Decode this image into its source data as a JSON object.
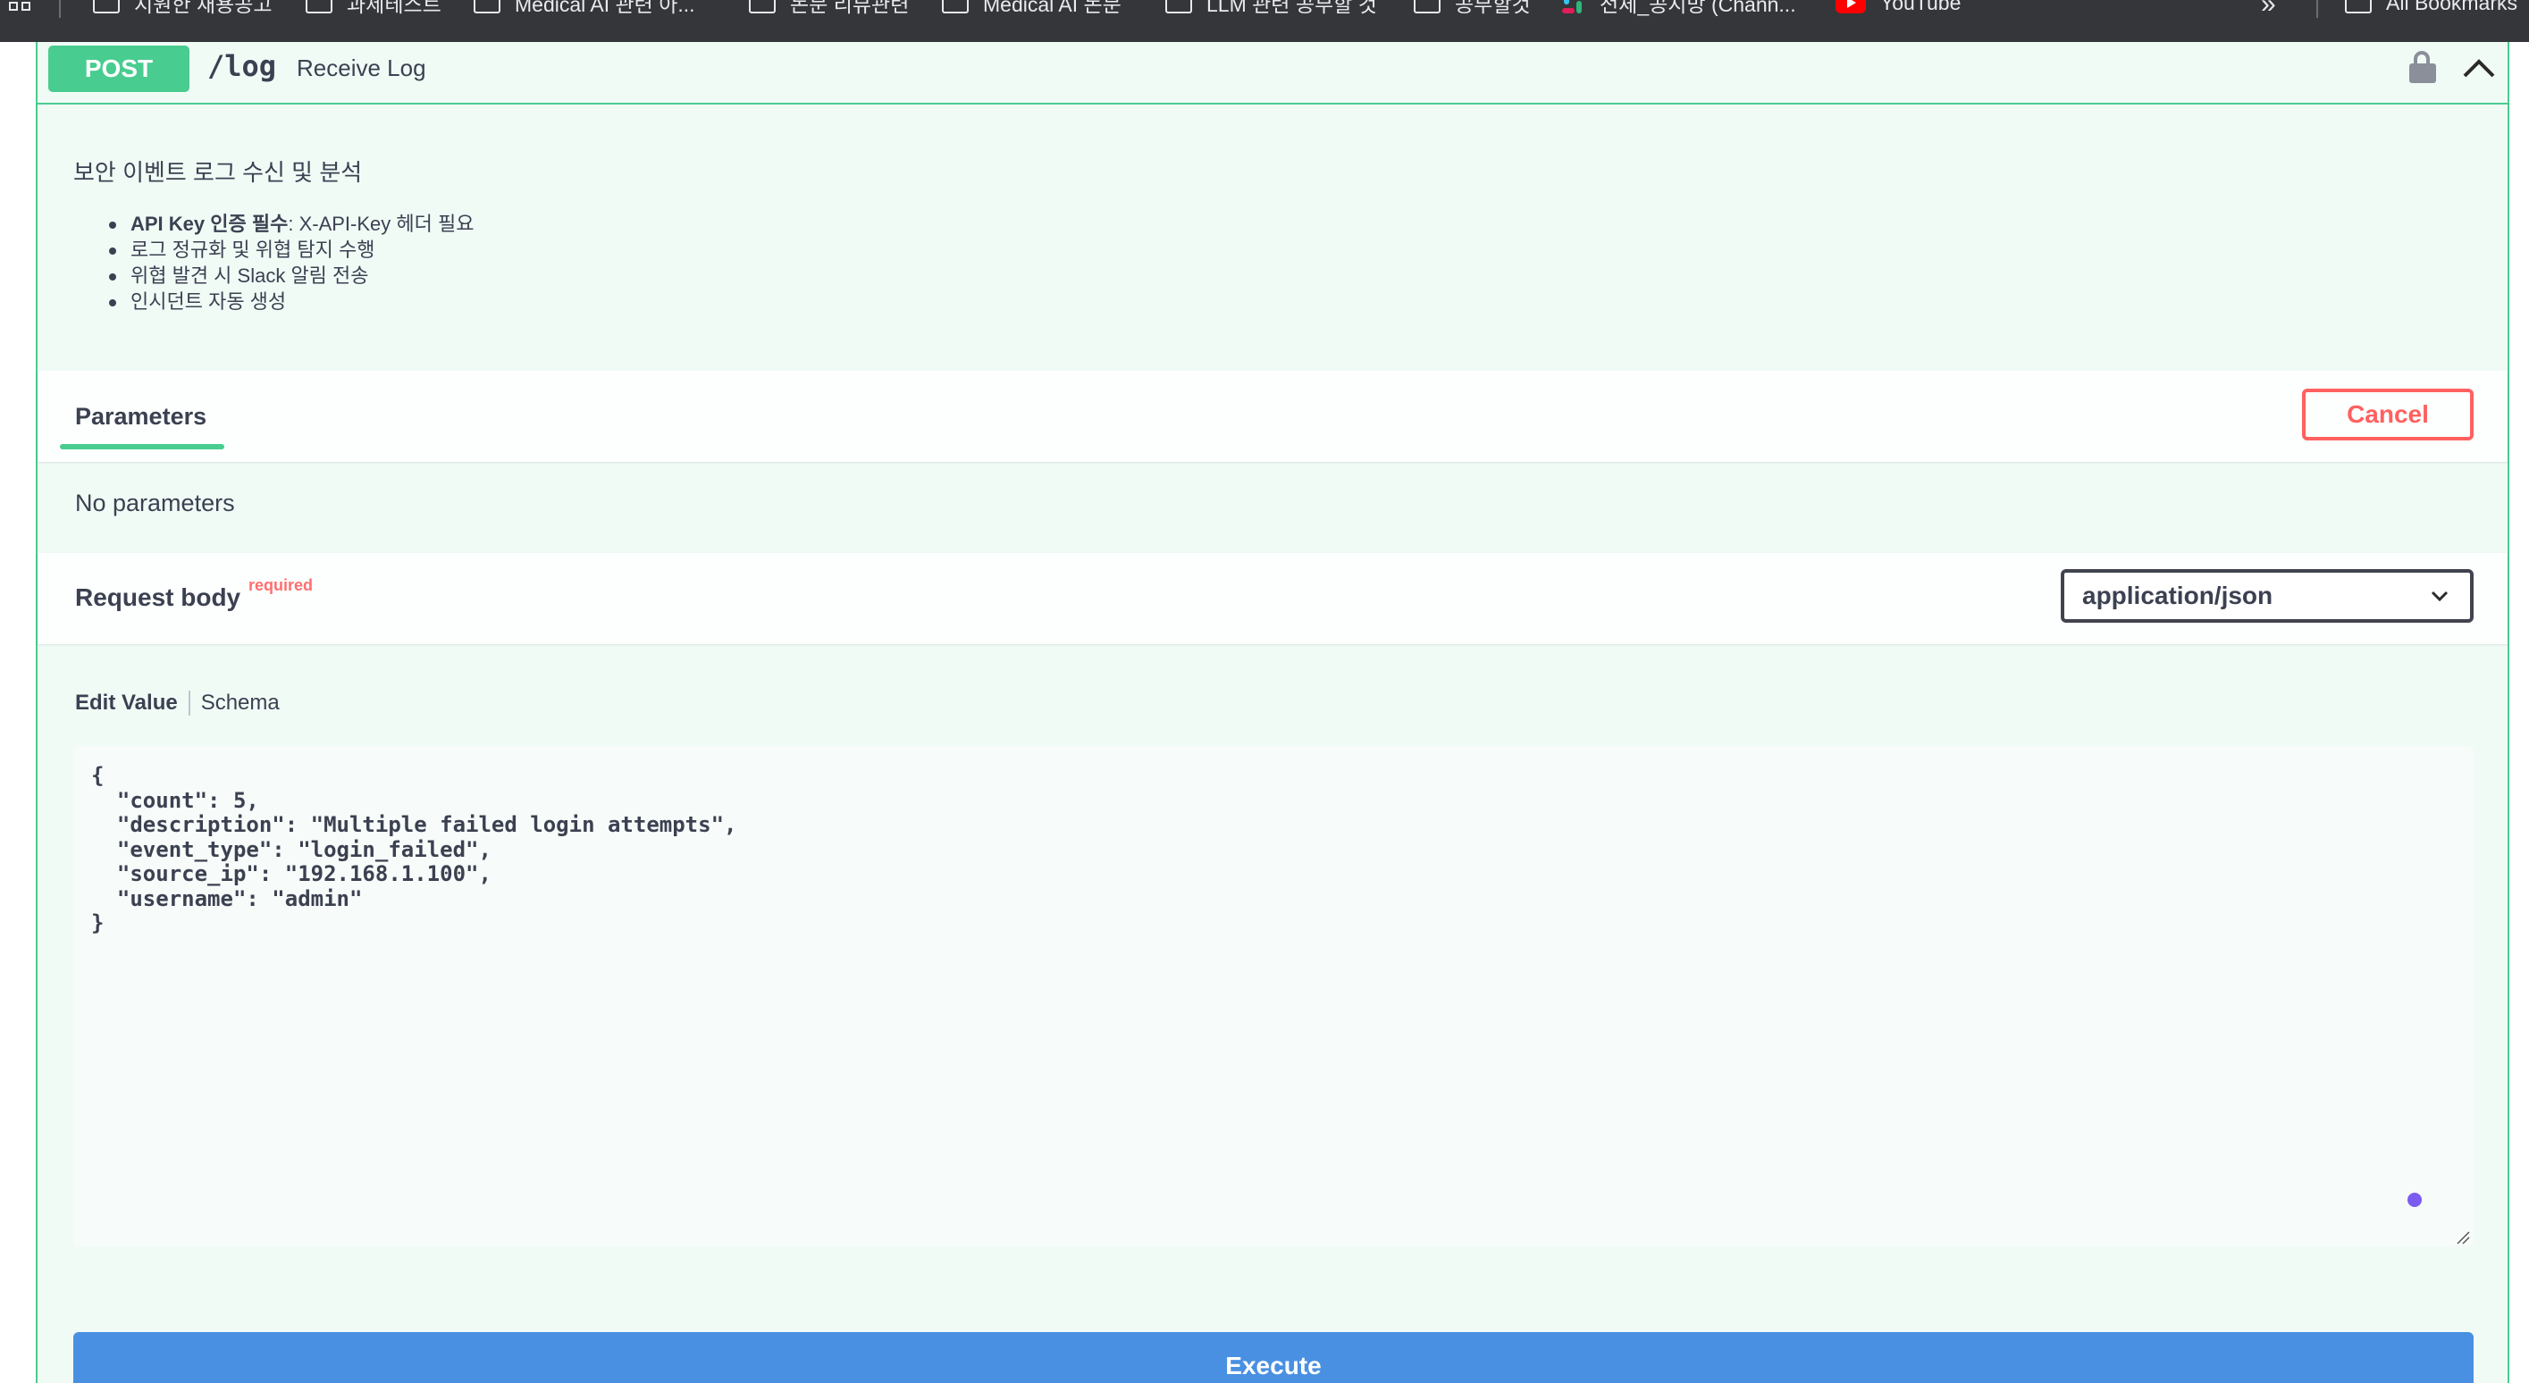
{
  "bookmarks": {
    "items": [
      {
        "label": "지원한 채용공고",
        "icon": "folder-icon"
      },
      {
        "label": "과제테스트",
        "icon": "folder-icon"
      },
      {
        "label": "Medical AI 관련 아...",
        "icon": "folder-icon"
      },
      {
        "label": "논문 리뷰관련",
        "icon": "folder-icon"
      },
      {
        "label": "Medical AI 논문",
        "icon": "folder-icon"
      },
      {
        "label": "LLM 관련 공부할 것",
        "icon": "folder-icon"
      },
      {
        "label": "공부할것",
        "icon": "folder-icon"
      },
      {
        "label": "전체_공지방 (Chann...",
        "icon": "slack-icon"
      },
      {
        "label": "YouTube",
        "icon": "youtube-icon"
      }
    ],
    "more_icon": "double-chevron-right-icon",
    "all_bookmarks": "All Bookmarks"
  },
  "operation": {
    "method": "POST",
    "path": "/log",
    "summary": "Receive Log",
    "accent_color": "#49cc90",
    "description_title": "보안 이벤트 로그 수신 및 분석",
    "description_items": [
      {
        "bold": "API Key 인증 필수",
        "text": ": X-API-Key 헤더 필요"
      },
      {
        "bold": "",
        "text": "로그 정규화 및 위협 탐지 수행"
      },
      {
        "bold": "",
        "text": "위협 발견 시 Slack 알림 전송"
      },
      {
        "bold": "",
        "text": "인시던트 자동 생성"
      }
    ]
  },
  "parameters": {
    "tab_label": "Parameters",
    "cancel_label": "Cancel",
    "cancel_color": "#ff6060",
    "empty_text": "No parameters"
  },
  "request_body": {
    "title": "Request body",
    "required_label": "required",
    "content_type": "application/json",
    "tabs": {
      "edit_value": "Edit Value",
      "schema": "Schema"
    },
    "editor_value": "{\n  \"count\": 5,\n  \"description\": \"Multiple failed login attempts\",\n  \"event_type\": \"login_failed\",\n  \"source_ip\": \"192.168.1.100\",\n  \"username\": \"admin\"\n}"
  },
  "execute": {
    "label": "Execute",
    "color": "#4990e2"
  }
}
